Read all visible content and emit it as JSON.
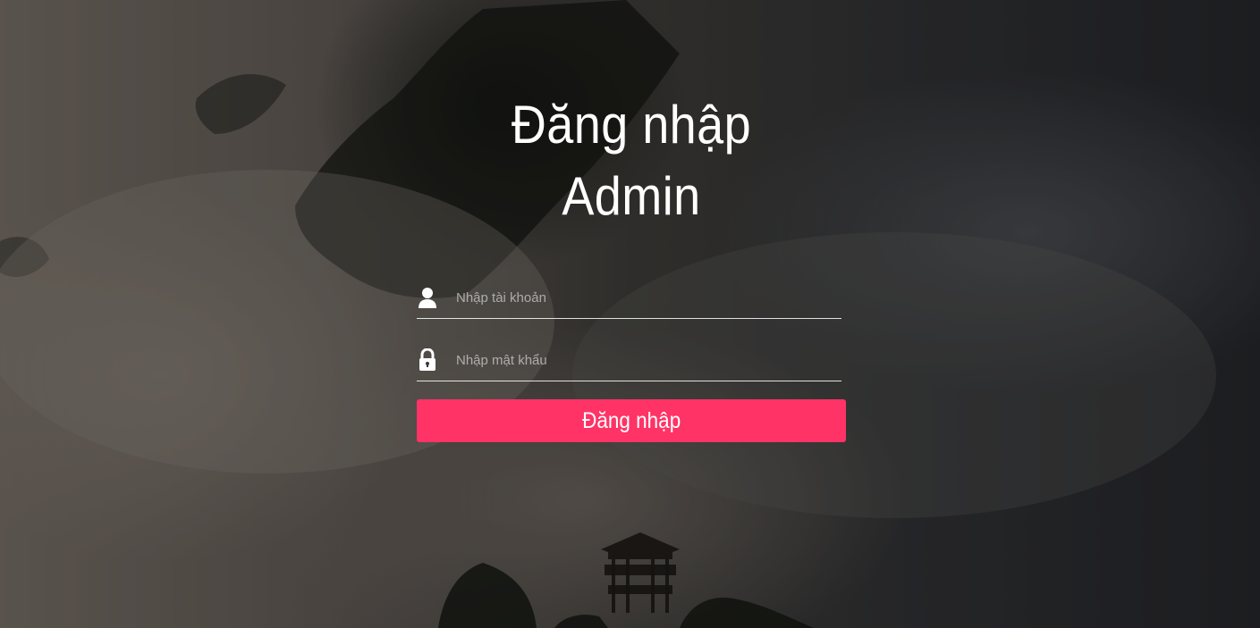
{
  "page": {
    "title": "Đăng nhập Admin"
  },
  "form": {
    "username_placeholder": "Nhập tài khoản",
    "username_value": "",
    "password_placeholder": "Nhập mật khẩu",
    "password_value": "",
    "submit_label": "Đăng nhập",
    "username_icon": "user-icon",
    "password_icon": "lock-icon"
  },
  "colors": {
    "accent": "#ff3366",
    "text": "#ffffff",
    "underline": "#ffffff"
  }
}
